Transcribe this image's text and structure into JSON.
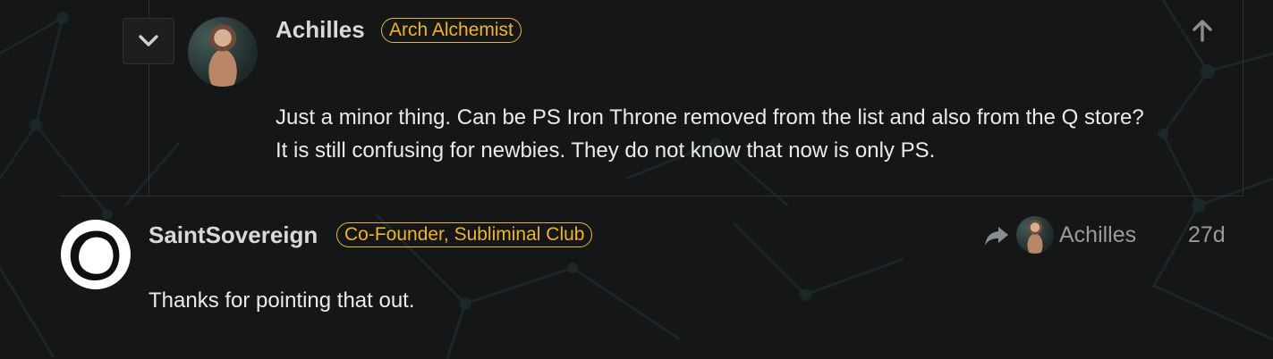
{
  "embedded_post": {
    "username": "Achilles",
    "badge": "Arch Alchemist",
    "text_line1": "Just a minor thing. Can be PS Iron Throne removed from the list and also from the Q store?",
    "text_line2": "It is still confusing for newbies. They do not know that now is only PS."
  },
  "post": {
    "username": "SaintSovereign",
    "badge": "Co-Founder, Subliminal Club",
    "reply_to_username": "Achilles",
    "date": "27d",
    "text": "Thanks for pointing that out."
  },
  "icons": {
    "collapse": "chevron-down-icon",
    "scroll_up": "arrow-up-icon",
    "reply": "share-reply-icon"
  },
  "colors": {
    "background": "#141617",
    "badge": "#f0b429",
    "muted_text": "#9a9a9a"
  }
}
